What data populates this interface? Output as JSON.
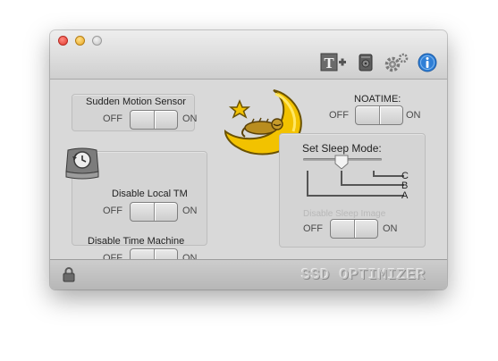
{
  "window": {
    "traffic_lights": [
      "close",
      "minimize",
      "zoom"
    ]
  },
  "toolbar": {
    "icons": [
      "text-plus-icon",
      "disk-icon",
      "gears-icon",
      "info-icon"
    ],
    "text_plus_glyph": "T+"
  },
  "sudden_motion_sensor": {
    "label": "Sudden Motion Sensor",
    "off": "OFF",
    "on": "ON"
  },
  "disable_local_tm": {
    "label": "Disable Local TM",
    "off": "OFF",
    "on": "ON"
  },
  "disable_time_machine": {
    "label": "Disable Time Machine",
    "off": "OFF",
    "on": "ON"
  },
  "noatime": {
    "label": "NOATIME:",
    "off": "OFF",
    "on": "ON"
  },
  "sleep_mode": {
    "label": "Set Sleep Mode:",
    "options": [
      "C",
      "B",
      "A"
    ],
    "slider_level": 0.5
  },
  "disable_sleep_image": {
    "label": "Disable Sleep Image",
    "off": "OFF",
    "on": "ON"
  },
  "statusbar": {
    "brand": "SSD OPTIMIZER"
  },
  "colors": {
    "moon": "#f2c200",
    "info_blue": "#2f7fd6",
    "close_red": "#e2392e",
    "min_yellow": "#e8a520"
  }
}
